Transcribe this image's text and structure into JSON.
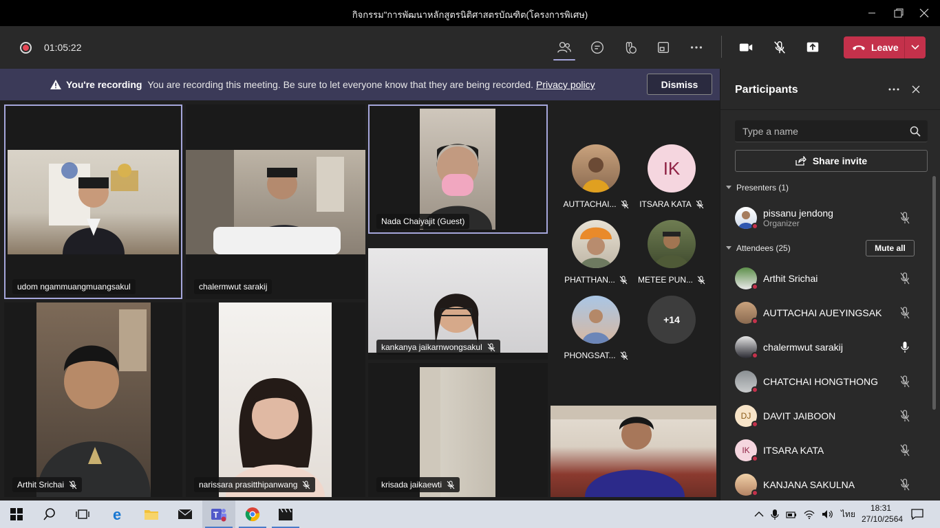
{
  "window": {
    "title": "กิจกรรม\"การพัฒนาหลักสูตรนิติศาสตรบัณฑิต(โครงการพิเศษ)"
  },
  "meeting": {
    "timer": "01:05:22",
    "leave_label": "Leave",
    "toolbar_icons": [
      "participants-icon",
      "chat-icon",
      "reactions-icon",
      "rooms-icon",
      "more-icon",
      "camera-icon",
      "mic-off-icon",
      "share-icon"
    ]
  },
  "banner": {
    "bold": "You're recording",
    "message": "You are recording this meeting. Be sure to let everyone know that they are being recorded.",
    "link": "Privacy policy",
    "dismiss": "Dismiss"
  },
  "tiles": [
    {
      "name": "udom ngammuangmuangsakul",
      "muted": false
    },
    {
      "name": "chalermwut sarakij",
      "muted": false
    },
    {
      "name": "Nada Chaiyajit (Guest)",
      "muted": false
    },
    {
      "name": "kankanya jaikarnwongsakul",
      "muted": true
    },
    {
      "name": "Arthit Srichai",
      "muted": true
    },
    {
      "name": "narissara prasitthipanwang",
      "muted": true
    },
    {
      "name": "krisada jaikaewti",
      "muted": true
    }
  ],
  "small_participants": [
    {
      "name": "AUTTACHAI...",
      "initials": ""
    },
    {
      "name": "ITSARA KATA",
      "initials": "IK"
    },
    {
      "name": "PHATTHAN...",
      "initials": ""
    },
    {
      "name": "METEE PUN...",
      "initials": ""
    },
    {
      "name": "PHONGSAT...",
      "initials": ""
    },
    {
      "name": "",
      "initials": "+14"
    }
  ],
  "panel": {
    "title": "Participants",
    "search_placeholder": "Type a name",
    "share_invite": "Share invite",
    "presenters_label": "Presenters (1)",
    "attendees_label": "Attendees (25)",
    "mute_all": "Mute all",
    "presenter": {
      "name": "pissanu jendong",
      "role": "Organizer"
    },
    "attendees": [
      {
        "name": "Arthit Srichai",
        "initials": "",
        "mic": "off"
      },
      {
        "name": "AUTTACHAI AUEYINGSAK",
        "initials": "",
        "mic": "off"
      },
      {
        "name": "chalermwut sarakij",
        "initials": "",
        "mic": "on"
      },
      {
        "name": "CHATCHAI HONGTHONG",
        "initials": "",
        "mic": "off"
      },
      {
        "name": "DAVIT JAIBOON",
        "initials": "DJ",
        "mic": "off"
      },
      {
        "name": "ITSARA KATA",
        "initials": "IK",
        "mic": "off"
      },
      {
        "name": "KANJANA SAKULNA",
        "initials": "",
        "mic": "off"
      }
    ]
  },
  "taskbar": {
    "time": "18:31",
    "date": "27/10/2564",
    "lang": "ไทย"
  },
  "colors": {
    "accent": "#a6a7dc",
    "leave": "#c4314b",
    "banner": "#3b3a58"
  }
}
